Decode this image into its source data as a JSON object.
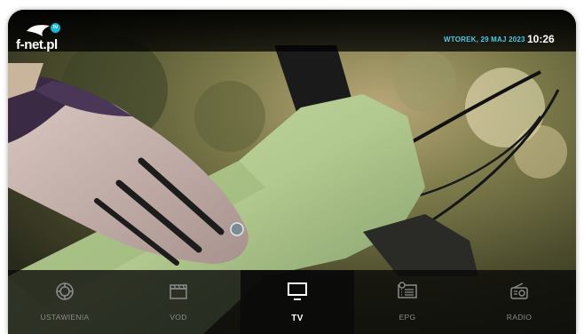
{
  "header": {
    "logo_text": "f-net.pl",
    "logo_badge": "tv",
    "date": "WTOREK, 29 MAJ 2023",
    "time": "10:26"
  },
  "nav": {
    "active": "TV",
    "items": [
      {
        "label": "USTAWIENIA",
        "icon": "settings-gear-icon"
      },
      {
        "label": "VOD",
        "icon": "clapperboard-icon"
      },
      {
        "label": "TV",
        "icon": "tv-monitor-icon"
      },
      {
        "label": "EPG",
        "icon": "program-guide-icon"
      },
      {
        "label": "RADIO",
        "icon": "radio-icon"
      }
    ]
  },
  "colors": {
    "accent": "#4fc6e8",
    "logo_badge": "#1ab6d6",
    "nav_inactive": "#8a8a8a",
    "nav_active": "#ffffff"
  }
}
